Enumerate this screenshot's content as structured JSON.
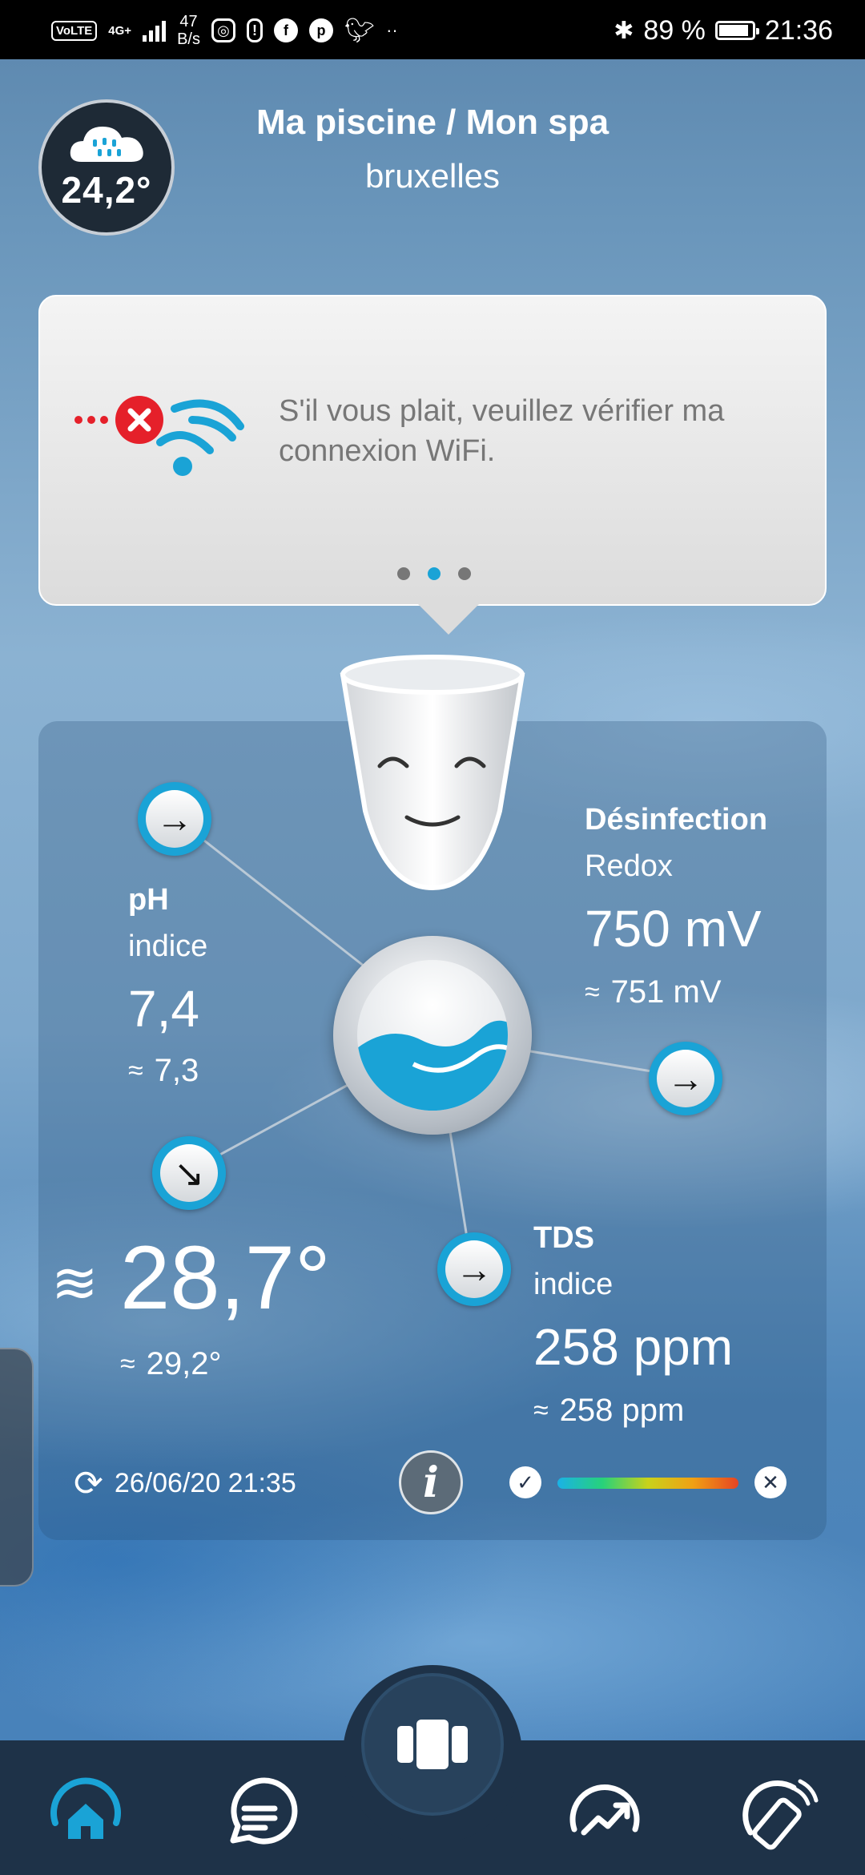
{
  "status_bar": {
    "volte": "VoLTE",
    "network": "4G+",
    "speed_value": "47",
    "speed_unit": "B/s",
    "more": "··",
    "battery_percent": "89 %",
    "battery_level": 0.89,
    "time": "21:36"
  },
  "header": {
    "weather_temp": "24,2°",
    "title": "Ma piscine / Mon spa",
    "location": "bruxelles"
  },
  "notice": {
    "message": "S'il vous plait, veuillez vérifier ma connexion WiFi.",
    "pages": 3,
    "active_page": 2
  },
  "readings": {
    "ph": {
      "label": "pH",
      "sublabel": "indice",
      "value": "7,4",
      "average": "7,3"
    },
    "disinfection": {
      "label": "Désinfection",
      "sublabel": "Redox",
      "value": "750 mV",
      "average": "751 mV"
    },
    "tds": {
      "label": "TDS",
      "sublabel": "indice",
      "value": "258 ppm",
      "average": "258 ppm"
    },
    "water_temp": {
      "value": "28,7°",
      "average": "29,2°"
    }
  },
  "footer": {
    "last_update": "26/06/20 21:35",
    "info_label": "i"
  },
  "colors": {
    "accent": "#1aa3d6",
    "nav_background": "#1e3248",
    "status_bar": "#000000"
  },
  "nav": {
    "items": [
      "home-icon",
      "chat-icon",
      "device-icon",
      "trend-icon",
      "remote-icon"
    ],
    "active": "home-icon"
  }
}
